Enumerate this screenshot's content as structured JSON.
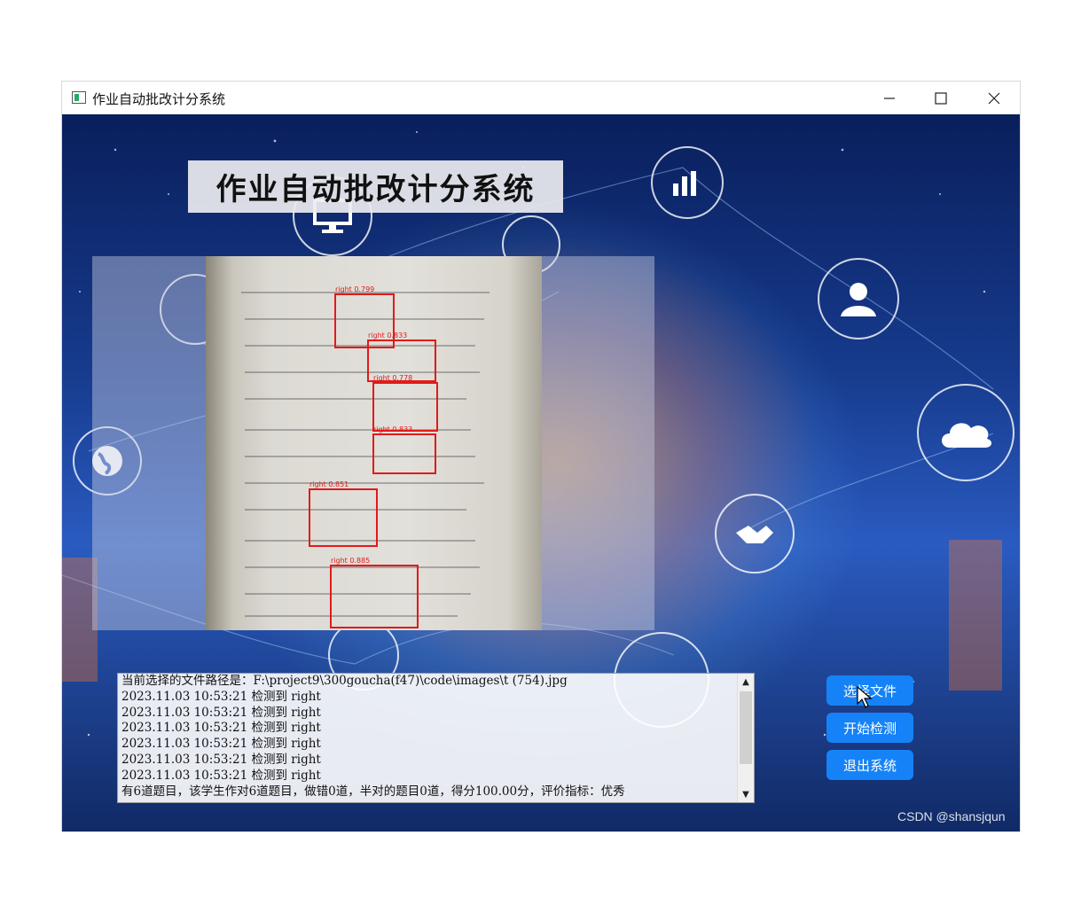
{
  "window": {
    "title": "作业自动批改计分系统"
  },
  "header": {
    "title": "作业自动批改计分系统"
  },
  "image_panel": {
    "detections": [
      {
        "label": "right 0.799"
      },
      {
        "label": "right 0.833"
      },
      {
        "label": "right 0.778"
      },
      {
        "label": "right 0.833"
      },
      {
        "label": "right 0.851"
      },
      {
        "label": "right 0.885"
      }
    ]
  },
  "log": {
    "lines": [
      "当前选择的文件路径是：F:\\project9\\300goucha(f47)\\code\\images\\t (754).jpg",
      "2023.11.03 10:53:21  检测到 right",
      "2023.11.03 10:53:21  检测到 right",
      "2023.11.03 10:53:21  检测到 right",
      "2023.11.03 10:53:21  检测到 right",
      "2023.11.03 10:53:21  检测到 right",
      "2023.11.03 10:53:21  检测到 right",
      "有6道题目，该学生作对6道题目，做错0道，半对的题目0道，得分100.00分，评价指标：优秀"
    ]
  },
  "buttons": {
    "select_file": "选择文件",
    "start_detect": "开始检测",
    "exit_system": "退出系统"
  },
  "footer": {
    "watermark": "CSDN @shansjqun"
  },
  "colors": {
    "button_bg": "#1583f7",
    "bbox": "#e21a1a"
  },
  "icons": [
    "window-app-icon",
    "minimize-icon",
    "maximize-icon",
    "close-icon",
    "mouse-cursor-icon"
  ]
}
